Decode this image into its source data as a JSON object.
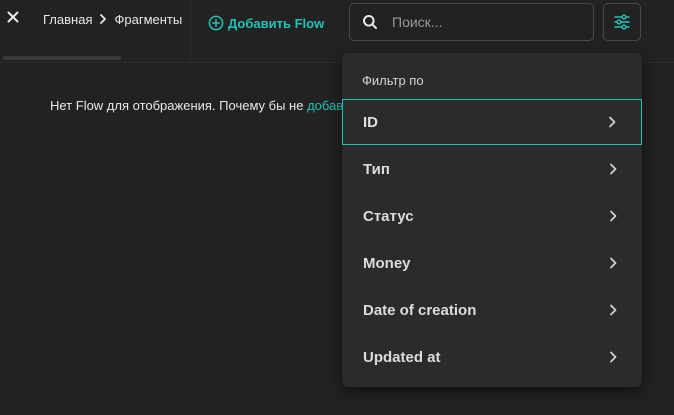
{
  "header": {
    "breadcrumb": [
      "Главная",
      "Фрагменты"
    ],
    "add_flow_label": "Добавить Flow"
  },
  "search": {
    "placeholder": "Поиск...",
    "value": ""
  },
  "empty_state": {
    "text": "Нет Flow для отображения. Почему бы не ",
    "link": "добавить"
  },
  "filter_menu": {
    "title": "Фильтр по",
    "items": [
      {
        "label": "ID",
        "active": true
      },
      {
        "label": "Тип",
        "active": false
      },
      {
        "label": "Статус",
        "active": false
      },
      {
        "label": "Money",
        "active": false
      },
      {
        "label": "Date of creation",
        "active": false
      },
      {
        "label": "Updated at",
        "active": false
      }
    ]
  },
  "colors": {
    "background": "#222222",
    "accent": "#21c3b6",
    "menu_background": "#2b2b2b",
    "border": "#4a4a4a"
  },
  "icons": {
    "close": "close-icon",
    "breadcrumb_separator": "chevron-right-icon",
    "add": "plus-circle-icon",
    "search": "search-icon",
    "filter": "sliders-icon",
    "menu_item": "chevron-right-icon"
  }
}
